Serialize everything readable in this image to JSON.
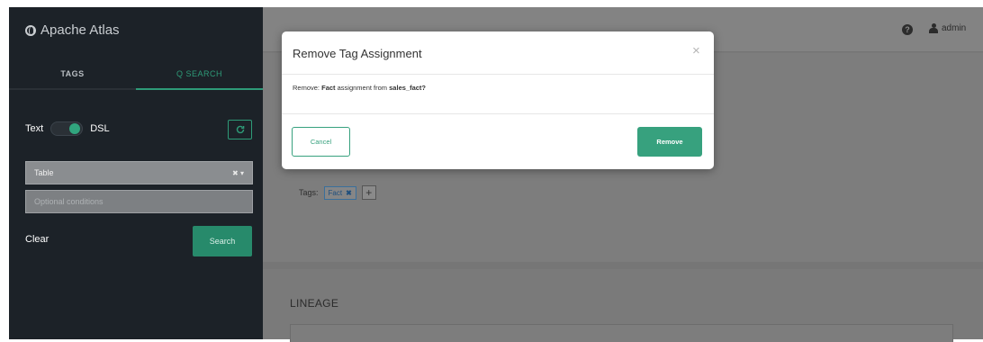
{
  "brand": {
    "name": "Apache Atlas",
    "icon": "globe-icon"
  },
  "sidebar": {
    "tabs": [
      {
        "label": "TAGS",
        "active": false
      },
      {
        "label": "Q SEARCH",
        "active": true
      }
    ],
    "toggle": {
      "left_label": "Text",
      "right_label": "DSL",
      "state": "DSL"
    },
    "refresh_icon": "refresh-icon",
    "type_select": {
      "value": "Table"
    },
    "conditions_input": {
      "value": "",
      "placeholder": "Optional conditions"
    },
    "clear_label": "Clear",
    "search_label": "Search"
  },
  "header": {
    "help_icon": "question-circle-icon",
    "user": {
      "name": "admin",
      "icon": "user-icon"
    }
  },
  "detail": {
    "tags_label": "Tags:",
    "tags": [
      {
        "label": "Fact",
        "remove": "✖"
      }
    ],
    "add_tag": "+",
    "lineage_title": "LINEAGE"
  },
  "modal": {
    "title": "Remove Tag Assignment",
    "close": "×",
    "body": {
      "prefix": "Remove: ",
      "tag": "Fact",
      "middle": " assignment from ",
      "entity": "sales_fact?"
    },
    "cancel_label": "Cancel",
    "confirm_label": "Remove"
  },
  "colors": {
    "accent": "#37a17e",
    "sidebar_bg": "#1c2228",
    "overlay_bg": "#7a7a7a"
  }
}
